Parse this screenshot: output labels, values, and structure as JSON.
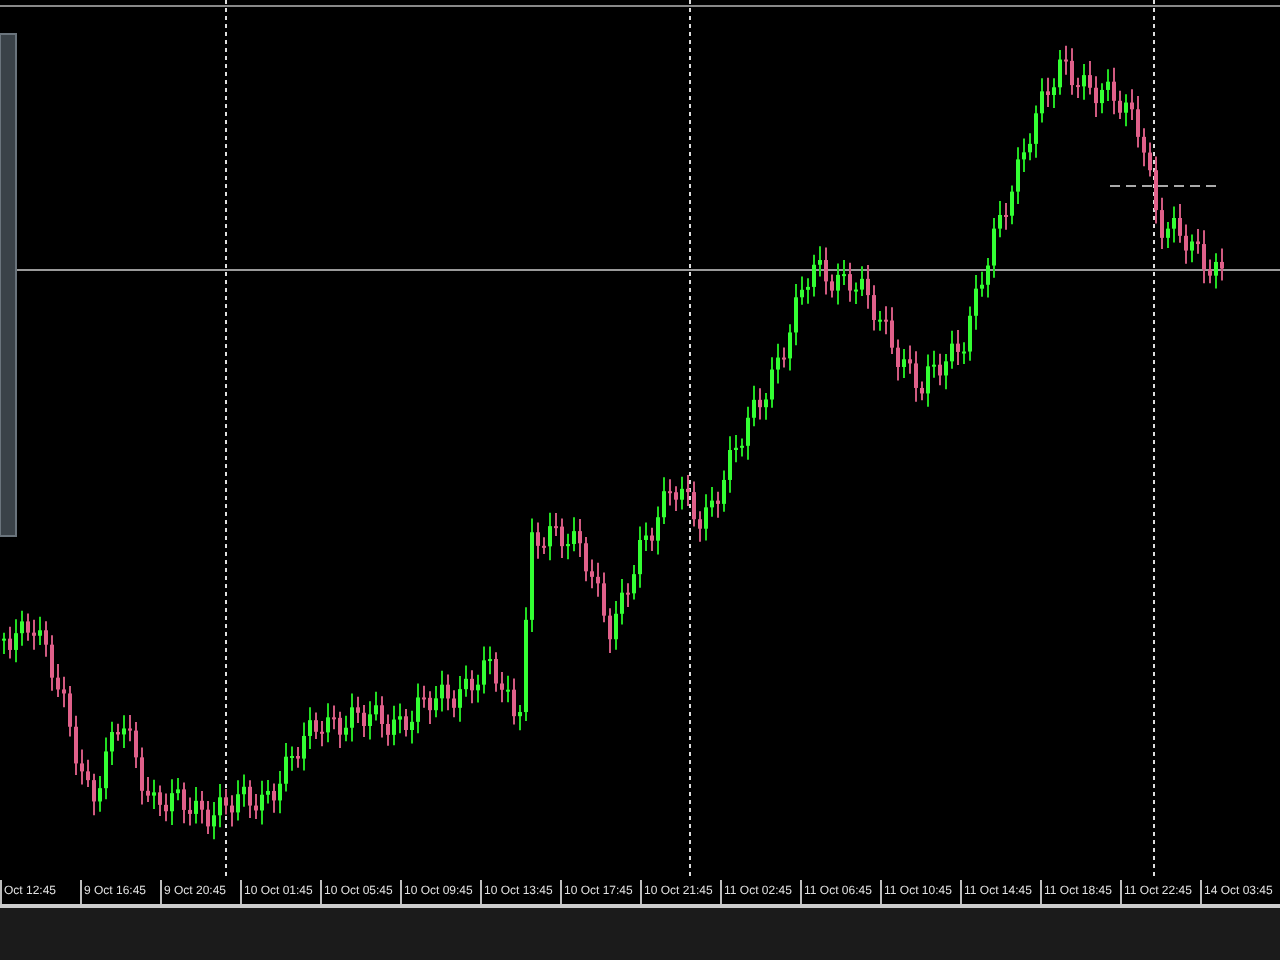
{
  "chart": {
    "kind": "candlestick"
  },
  "time_axis": {
    "labels": [
      "Oct 12:45",
      "9 Oct 16:45",
      "9 Oct 20:45",
      "10 Oct 01:45",
      "10 Oct 05:45",
      "10 Oct 09:45",
      "10 Oct 13:45",
      "10 Oct 17:45",
      "10 Oct 21:45",
      "11 Oct 02:45",
      "11 Oct 06:45",
      "11 Oct 10:45",
      "11 Oct 14:45",
      "11 Oct 18:45",
      "11 Oct 22:45",
      "14 Oct 03:45"
    ]
  }
}
